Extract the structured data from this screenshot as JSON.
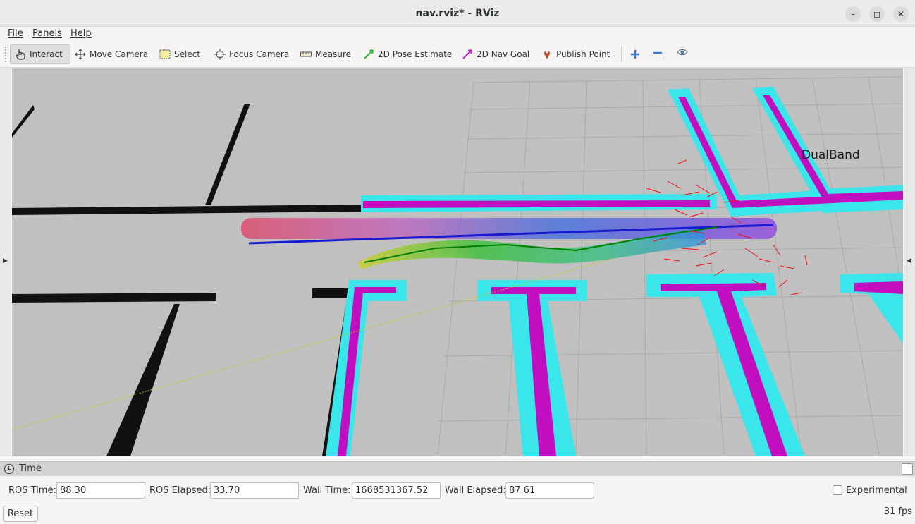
{
  "window": {
    "title": "nav.rviz* - RViz"
  },
  "menu": [
    "File",
    "Panels",
    "Help"
  ],
  "toolbar": {
    "tools": [
      {
        "label": "Interact",
        "icon": "hand-pointer-icon"
      },
      {
        "label": "Move Camera",
        "icon": "move-arrows-icon"
      },
      {
        "label": "Select",
        "icon": "select-box-icon"
      },
      {
        "label": "Focus Camera",
        "icon": "focus-crosshair-icon"
      },
      {
        "label": "Measure",
        "icon": "ruler-icon"
      },
      {
        "label": "2D Pose Estimate",
        "icon": "green-arrow-icon"
      },
      {
        "label": "2D Nav Goal",
        "icon": "magenta-arrow-icon"
      },
      {
        "label": "Publish Point",
        "icon": "map-pin-icon"
      }
    ],
    "active": "Interact"
  },
  "viewport": {
    "overlay_label": "DualBand"
  },
  "time_panel": {
    "title": "Time",
    "ros_time_label": "ROS Time:",
    "ros_time": "88.30",
    "ros_elapsed_label": "ROS Elapsed:",
    "ros_elapsed": "33.70",
    "wall_time_label": "Wall Time:",
    "wall_time": "1668531367.52",
    "wall_elapsed_label": "Wall Elapsed:",
    "wall_elapsed": "87.61",
    "experimental_label": "Experimental",
    "experimental_checked": false,
    "reset_label": "Reset",
    "fps": "31 fps"
  },
  "colors": {
    "map_wall": "#111111",
    "inflation": "#3de8e8",
    "lethal": "#c010c0",
    "grid": "#a8a8a8",
    "floor": "#c0c0c0"
  }
}
